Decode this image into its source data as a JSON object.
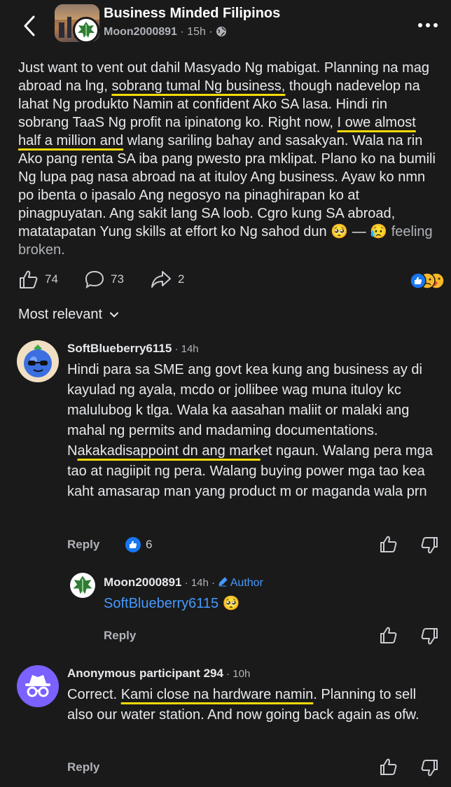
{
  "header": {
    "group_name": "Business Minded Filipinos",
    "author": "Moon2000891",
    "separator": "·",
    "time": "15h",
    "dot": "·"
  },
  "post": {
    "p1": "Just want to vent out dahil Masyado Ng mabigat. Planning na mag abroad na lng, ",
    "h1": "sobrang tumal Ng business,",
    "p2": " though nadevelop na lahat Ng produkto Namin at confident Ako SA lasa. Hindi rin sobrang TaaS Ng profit na ipinatong ko. Right now, ",
    "h2": "I owe almost half a million and",
    "p3": " wlang sariling bahay and sasakyan. Wala na rin Ako pang renta SA iba pang pwesto pra mklipat. Plano ko na bumili Ng lupa pag nasa abroad na at ituloy Ang business. Ayaw ko nmn po ibenta o ipasalo Ang negosyo na pinaghirapan ko at pinagpuyatan. Ang sakit lang SA loob. Cgro kung SA abroad, matatapatan Yung skills at effort ko Ng sahod dun ",
    "emoji1": "🥺",
    "dash": " — ",
    "emoji2": "😥",
    "feeling": " feeling broken."
  },
  "actions": {
    "likes": "74",
    "comments": "73",
    "shares": "2"
  },
  "sort": {
    "label": "Most relevant"
  },
  "comments": [
    {
      "name": "SoftBlueberry6115",
      "time": " · 14h",
      "t1": "Hindi para sa SME ang govt kea kung ang business ay di kayulad ng ayala, mcdo or jollibee wag muna ituloy kc malulubog k tlga. Wala ka aasahan maliit or malaki ang mahal ng permits and madaming documentations. N",
      "h": "akakadisappoint dn ang mark",
      "t2": "et ngaun. Walang pera mga tao at nagiipit ng pera. Walang buying power mga tao kea kaht amasarap man yang product m or maganda wala prn",
      "reply": "Reply",
      "likes": "6"
    },
    {
      "name": "Moon2000891",
      "time": " · 14h · ",
      "author_badge": "Author",
      "mention": "SoftBlueberry6115",
      "emoji": "🥺",
      "reply": "Reply"
    },
    {
      "name": "Anonymous participant 294",
      "time": " · 10h",
      "t1": "Correct. ",
      "h": "Kami close na hardware namin",
      "t2": ". Planning to sell also our water station. And now going back again as ofw.",
      "reply": "Reply"
    }
  ],
  "colors": {
    "background": "#1a1a1a",
    "accent_blue": "#4599ff",
    "highlight_yellow": "#f5d90a"
  },
  "icons": [
    "back-arrow-icon",
    "globe-icon",
    "more-dots-icon",
    "thumbs-up-icon",
    "comment-bubble-icon",
    "share-arrow-icon",
    "reaction-like-icon",
    "reaction-sad-icon",
    "reaction-care-icon",
    "chevron-down-icon",
    "upvote-icon",
    "downvote-icon",
    "pencil-icon",
    "incognito-icon"
  ]
}
